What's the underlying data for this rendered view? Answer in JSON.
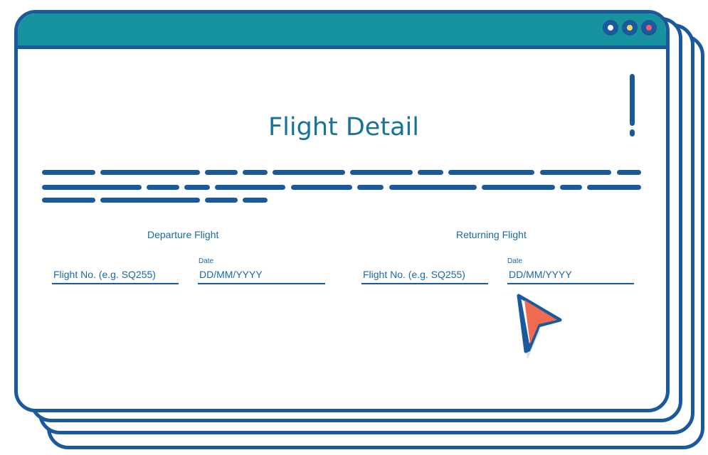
{
  "page_title": "Flight Detail",
  "window_buttons": [
    {
      "name": "window-button-1",
      "color": "#ffffff"
    },
    {
      "name": "window-button-2",
      "color": "#f3d36b"
    },
    {
      "name": "window-button-3",
      "color": "#ef5e6a"
    }
  ],
  "departure": {
    "title": "Departure Flight",
    "flight_no_placeholder": "Flight No. (e.g. SQ255)",
    "date_label": "Date",
    "date_placeholder": "DD/MM/YYYY"
  },
  "returning": {
    "title": "Returning Flight",
    "flight_no_placeholder": "Flight No. (e.g. SQ255)",
    "date_label": "Date",
    "date_placeholder": "DD/MM/YYYY"
  },
  "colors": {
    "frame": "#1a5a9c",
    "titlebar": "#17929f",
    "accent_text": "#17739a",
    "cursor": "#f06b4f"
  },
  "cursor_icon": "arrow-pointer-icon"
}
